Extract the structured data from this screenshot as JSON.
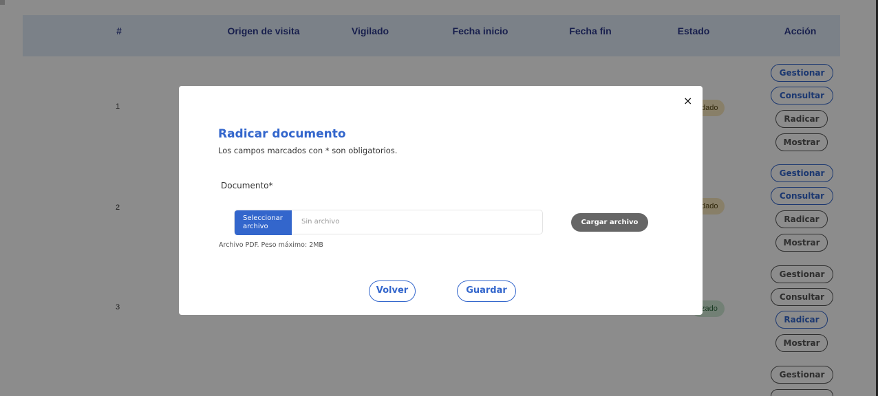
{
  "table": {
    "headers": [
      "#",
      "Origen de visita",
      "Vigilado",
      "Fecha inicio",
      "Fecha fin",
      "Estado",
      "Acción"
    ],
    "rows": [
      {
        "num": "1",
        "estado_partial": "dado",
        "estado_color": "#f7e7bd",
        "actions": [
          {
            "label": "Gestionar",
            "style": "blue"
          },
          {
            "label": "Consultar",
            "style": "blue"
          },
          {
            "label": "Radicar",
            "style": "grey"
          },
          {
            "label": "Mostrar",
            "style": "grey"
          }
        ]
      },
      {
        "num": "2",
        "estado_partial": "dado",
        "estado_color": "#f7e7bd",
        "actions": [
          {
            "label": "Gestionar",
            "style": "blue"
          },
          {
            "label": "Consultar",
            "style": "blue"
          },
          {
            "label": "Radicar",
            "style": "grey"
          },
          {
            "label": "Mostrar",
            "style": "grey"
          }
        ]
      },
      {
        "num": "3",
        "estado_partial": "zado",
        "estado_color": "#cfe9d6",
        "actions": [
          {
            "label": "Gestionar",
            "style": "grey"
          },
          {
            "label": "Consultar",
            "style": "grey"
          },
          {
            "label": "Radicar",
            "style": "blue"
          },
          {
            "label": "Mostrar",
            "style": "grey"
          }
        ]
      },
      {
        "num": "",
        "actions": [
          {
            "label": "Gestionar",
            "style": "grey"
          }
        ]
      }
    ]
  },
  "modal": {
    "close_symbol": "×",
    "title": "Radicar documento",
    "subtitle": "Los campos marcados con * son obligatorios.",
    "document_label": "Documento*",
    "select_file_label": "Seleccionar archivo",
    "file_placeholder": "Sin archivo",
    "upload_label": "Cargar archivo",
    "hint": "Archivo PDF. Peso máximo: 2MB",
    "back_label": "Volver",
    "save_label": "Guardar"
  },
  "colors": {
    "accent": "#3366cc",
    "header_bg": "#e0ebf8",
    "upload_bg": "#666666"
  }
}
